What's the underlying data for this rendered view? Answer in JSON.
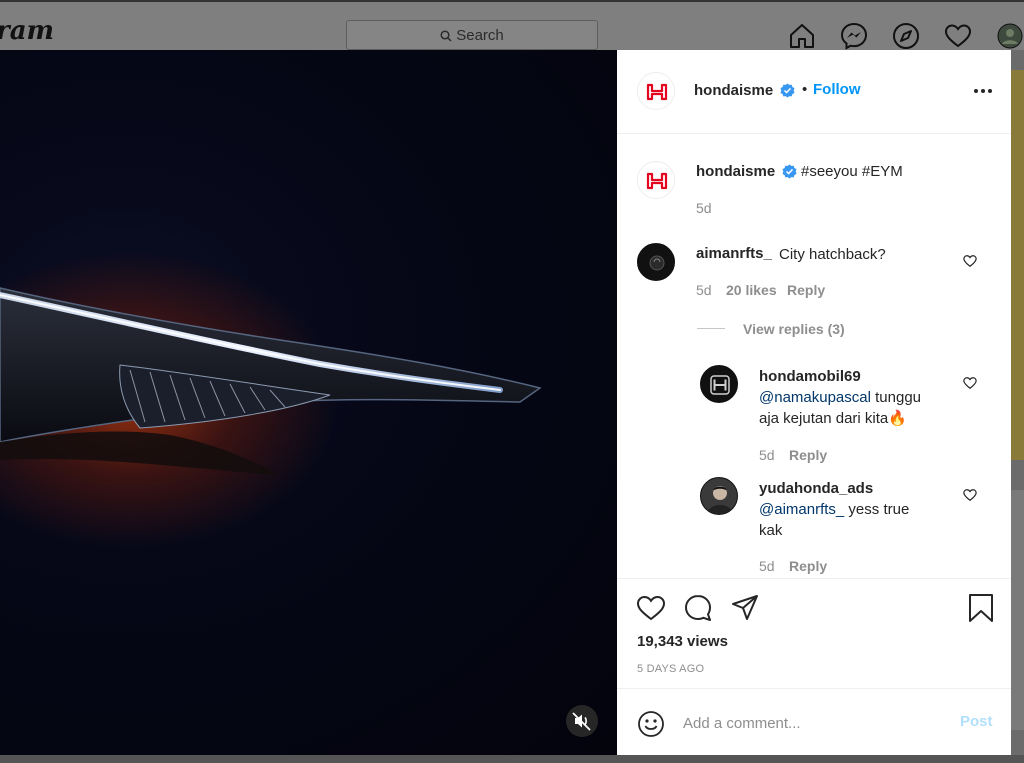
{
  "app": {
    "logo_text": "ram",
    "search_placeholder": "Search"
  },
  "post": {
    "author": "hondaisme",
    "follow_label": "Follow",
    "separator": "•",
    "caption": {
      "author": "hondaisme",
      "hashtags": "#seeyou #EYM",
      "time": "5d"
    },
    "comments": [
      {
        "user": "aimanrfts_",
        "text": "City hatchback?",
        "time": "5d",
        "likes": "20 likes",
        "reply_label": "Reply",
        "view_replies": "View replies (3)"
      }
    ],
    "replies": [
      {
        "user": "hondamobil69",
        "mention": "@namakupascal",
        "text_line1": " tunggu",
        "text_line2": "aja kejutan dari kita🔥",
        "time": "5d",
        "reply_label": "Reply"
      },
      {
        "user": "yudahonda_ads",
        "mention": "@aimanrfts_",
        "text_line1": " yess true",
        "text_line2": "kak",
        "time": "5d",
        "reply_label": "Reply"
      }
    ],
    "views": "19,343 views",
    "posted_ago": "5 DAYS AGO",
    "comment_placeholder": "Add a comment...",
    "post_label": "Post"
  },
  "colors": {
    "accent": "#0095f6",
    "honda_red": "#e40521",
    "link": "#00376b"
  }
}
